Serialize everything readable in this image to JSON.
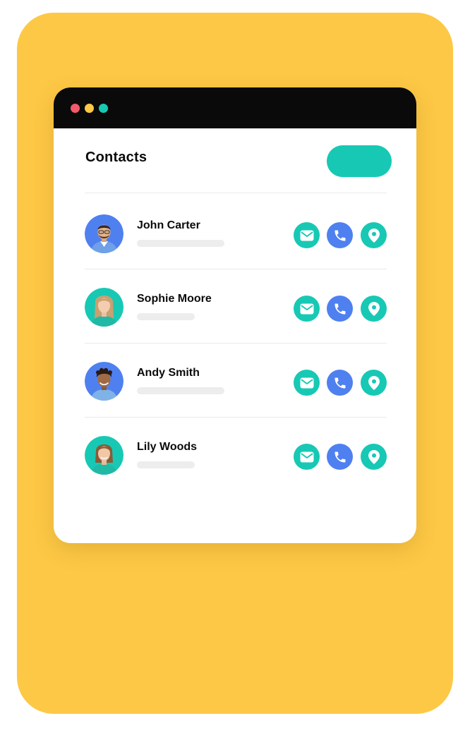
{
  "colors": {
    "background_card": "#FDC845",
    "titlebar": "#0A0A0A",
    "window": "#FFFFFF",
    "accent_teal": "#17C9B4",
    "accent_blue": "#4F80F0",
    "dot_red": "#F15A6C",
    "dot_yellow": "#FDC845",
    "dot_green": "#17C9B4",
    "skeleton": "#EDEDED"
  },
  "header": {
    "title": "Contacts",
    "action_button_label": ""
  },
  "contacts": [
    {
      "name": "John Carter",
      "avatar_bg": "#4F80F0",
      "avatar_icon": "man-avatar-icon",
      "actions": [
        "email-icon",
        "phone-icon",
        "location-pin-icon"
      ]
    },
    {
      "name": "Sophie Moore",
      "avatar_bg": "#17C9B4",
      "avatar_icon": "woman-avatar-icon",
      "actions": [
        "email-icon",
        "phone-icon",
        "location-pin-icon"
      ]
    },
    {
      "name": "Andy Smith",
      "avatar_bg": "#4F80F0",
      "avatar_icon": "man-avatar-icon",
      "actions": [
        "email-icon",
        "phone-icon",
        "location-pin-icon"
      ]
    },
    {
      "name": "Lily Woods",
      "avatar_bg": "#17C9B4",
      "avatar_icon": "woman-avatar-icon",
      "actions": [
        "email-icon",
        "phone-icon",
        "location-pin-icon"
      ]
    }
  ]
}
